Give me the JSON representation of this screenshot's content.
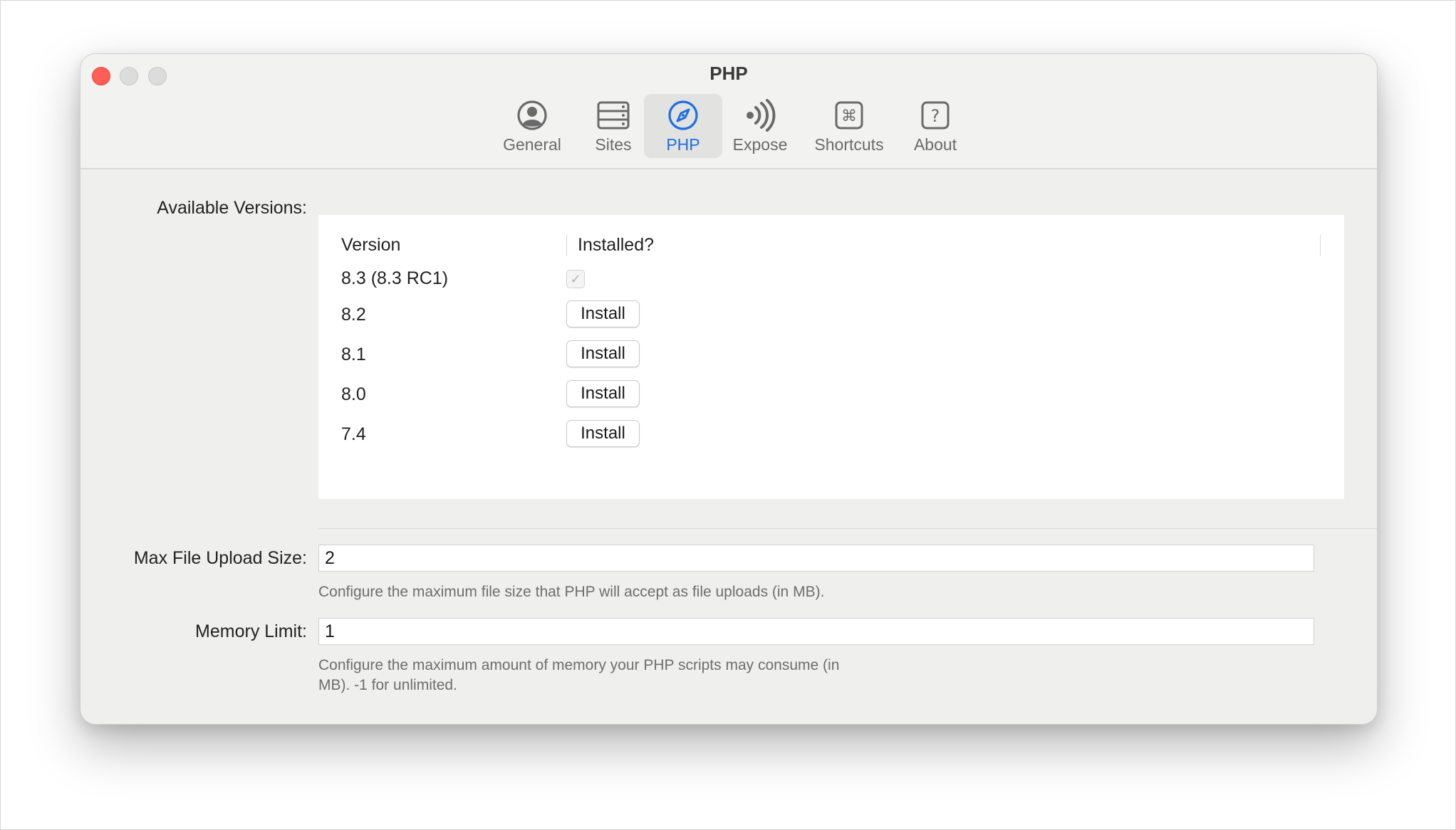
{
  "window": {
    "title": "PHP"
  },
  "toolbar": {
    "tabs": [
      {
        "label": "General",
        "icon": "person-circle-icon",
        "active": false
      },
      {
        "label": "Sites",
        "icon": "server-rack-icon",
        "active": false
      },
      {
        "label": "PHP",
        "icon": "compass-icon",
        "active": true
      },
      {
        "label": "Expose",
        "icon": "broadcast-waves-icon",
        "active": false
      },
      {
        "label": "Shortcuts",
        "icon": "command-key-icon",
        "active": false
      },
      {
        "label": "About",
        "icon": "question-mark-icon",
        "active": false
      }
    ],
    "active_color": "#1f6fe0"
  },
  "versions": {
    "label": "Available Versions:",
    "columns": [
      "Version",
      "Installed?"
    ],
    "rows": [
      {
        "version": "8.3 (8.3 RC1)",
        "installed": true
      },
      {
        "version": "8.2",
        "installed": false,
        "action": "Install"
      },
      {
        "version": "8.1",
        "installed": false,
        "action": "Install"
      },
      {
        "version": "8.0",
        "installed": false,
        "action": "Install"
      },
      {
        "version": "7.4",
        "installed": false,
        "action": "Install"
      }
    ]
  },
  "upload": {
    "label": "Max File Upload Size:",
    "value": "2",
    "help": "Configure the maximum file size that PHP will accept as file uploads (in MB)."
  },
  "memory": {
    "label": "Memory Limit:",
    "value": "1",
    "help_line1": "Configure the maximum amount of memory your PHP scripts may consume (in",
    "help_line2": "MB). -1 for unlimited."
  }
}
